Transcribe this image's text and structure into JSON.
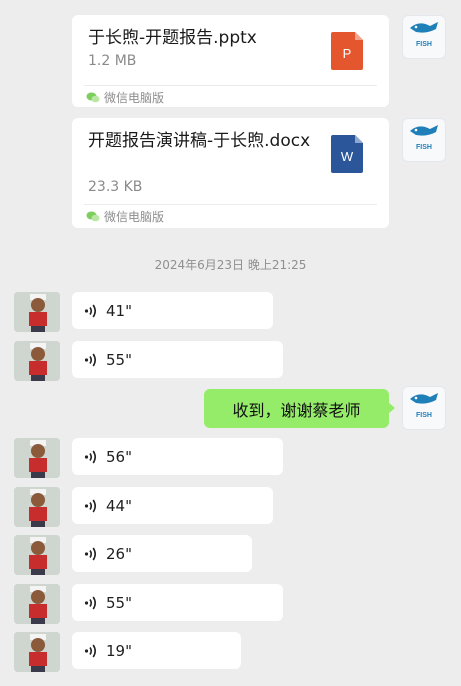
{
  "files": [
    {
      "name": "于长煦-开题报告.pptx",
      "size": "1.2 MB",
      "source": "微信电脑版",
      "type_icon": "ppt-file-icon",
      "icon_letter": "P",
      "icon_color": "#e4572e"
    },
    {
      "name": "开题报告演讲稿-于长煦.docx",
      "size": "23.3 KB",
      "source": "微信电脑版",
      "type_icon": "word-file-icon",
      "icon_letter": "W",
      "icon_color": "#2b579a"
    }
  ],
  "timestamp": "2024年6月23日 晚上21:25",
  "voice_messages": [
    {
      "duration": "41\""
    },
    {
      "duration": "55\""
    },
    {
      "duration": "56\""
    },
    {
      "duration": "44\""
    },
    {
      "duration": "26\""
    },
    {
      "duration": "55\""
    },
    {
      "duration": "19\""
    }
  ],
  "sent_message": {
    "text": "收到，谢谢蔡老师"
  },
  "self_avatar_text": "FISH",
  "colors": {
    "background": "#ededed",
    "sent_bubble": "#95ec69",
    "received_bubble": "#ffffff",
    "wechat_green": "#07c160"
  }
}
